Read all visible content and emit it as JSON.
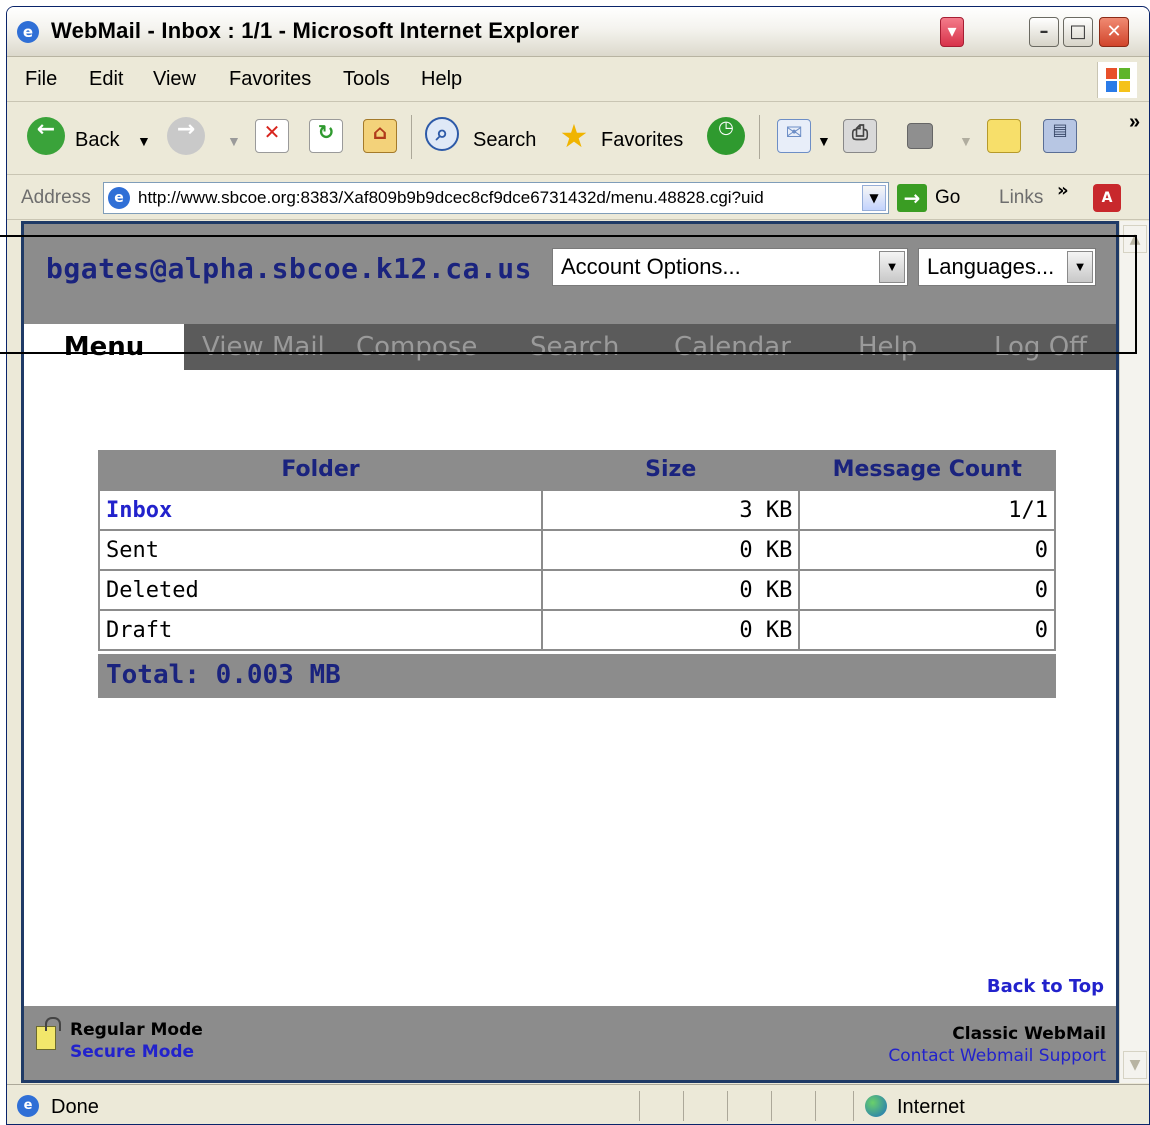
{
  "window": {
    "title": "WebMail - Inbox : 1/1 - Microsoft Internet Explorer",
    "controls": {
      "minimize": "–",
      "maximize": "□",
      "close": "✕"
    }
  },
  "menubar": {
    "items": [
      "File",
      "Edit",
      "View",
      "Favorites",
      "Tools",
      "Help"
    ]
  },
  "toolbar": {
    "back_label": "Back",
    "search_label": "Search",
    "favorites_label": "Favorites",
    "more_chevron": "»"
  },
  "addressbar": {
    "label": "Address",
    "url": "http://www.sbcoe.org:8383/Xaf809b9b9dcec8cf9dce6731432d/menu.48828.cgi?uid",
    "go_label": "Go",
    "links_label": "Links"
  },
  "webmail": {
    "user_email": "bgates@alpha.sbcoe.k12.ca.us",
    "account_select": "Account Options...",
    "language_select": "Languages...",
    "tabs": [
      "Menu",
      "View Mail",
      "Compose",
      "Search",
      "Calendar",
      "Help",
      "Log Off"
    ],
    "active_tab": "Menu",
    "table": {
      "headers": [
        "Folder",
        "Size",
        "Message Count"
      ],
      "rows": [
        {
          "folder": "Inbox",
          "size": "3 KB",
          "count": "1/1"
        },
        {
          "folder": "Sent",
          "size": "0 KB",
          "count": "0"
        },
        {
          "folder": "Deleted",
          "size": "0 KB",
          "count": "0"
        },
        {
          "folder": "Draft",
          "size": "0 KB",
          "count": "0"
        }
      ],
      "total": "Total: 0.003 MB"
    },
    "back_to_top": "Back to Top",
    "footer": {
      "regular_mode": "Regular Mode",
      "secure_mode": "Secure Mode",
      "classic": "Classic WebMail",
      "support": "Contact Webmail Support"
    }
  },
  "statusbar": {
    "status": "Done",
    "zone": "Internet"
  },
  "colors": {
    "header_gray": "#8c8c8c",
    "tab_dark": "#5b5b5b",
    "link_blue": "#2222cc",
    "navy_text": "#1a237e"
  }
}
